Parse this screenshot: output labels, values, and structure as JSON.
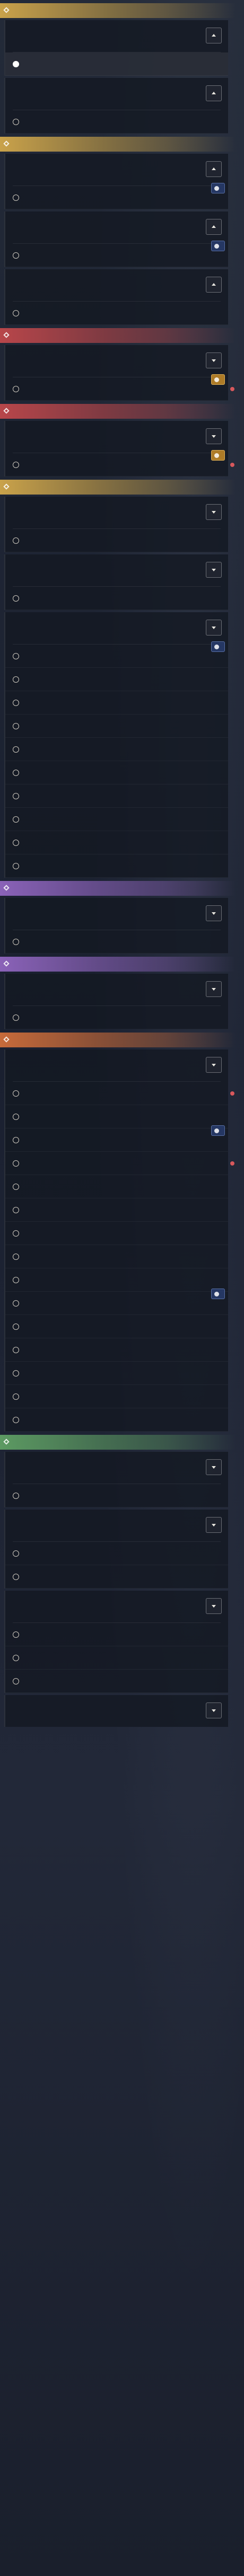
{
  "colors": {
    "gold": "#c9a24a",
    "red": "#b8464a",
    "purple": "#8a62b8",
    "orange": "#c66a3a",
    "green": "#5c9a62",
    "panel": "#14182a",
    "text": "#e8e6df"
  },
  "icons": {
    "category": "category-diamond-icon",
    "toggle_up": "chevron-up-icon",
    "toggle_down": "chevron-down-icon",
    "checkbox": "radio-circle-icon",
    "tag": "tag-badge-icon"
  },
  "sections": [
    {
      "category": "",
      "color": "gold",
      "quests": [
        {
          "title": "",
          "subtitle": "",
          "toggle": "up",
          "rows": [
            {
              "label": "",
              "highlight": true
            }
          ]
        },
        {
          "title": "",
          "subtitle": "",
          "toggle": "up",
          "rows": [
            {
              "label": "",
              "distance": ""
            }
          ]
        }
      ]
    },
    {
      "category": "",
      "color": "gold",
      "quests": [
        {
          "title": "",
          "subtitle": "",
          "toggle": "up",
          "rows": [
            {
              "label": "",
              "distance": "",
              "tag": "",
              "tag_style": "blue"
            }
          ]
        },
        {
          "title": "",
          "subtitle": "",
          "toggle": "up",
          "rows": [
            {
              "label": "",
              "distance": "",
              "tag": "",
              "tag_style": "blue"
            }
          ]
        },
        {
          "title": "",
          "subtitle": "",
          "toggle": "up",
          "rows": [
            {
              "label": "",
              "distance": ""
            }
          ]
        }
      ]
    },
    {
      "category": "",
      "color": "red",
      "quests": [
        {
          "title": "",
          "subtitle": "",
          "toggle": "down",
          "rows": [
            {
              "label": "",
              "dim": true,
              "tag": "",
              "tag_style": "amber",
              "side_dot": true
            }
          ]
        }
      ]
    },
    {
      "category": "",
      "color": "red",
      "quests": [
        {
          "title": "",
          "subtitle": "",
          "toggle": "down",
          "rows": [
            {
              "label": "",
              "dim": true,
              "tag": "",
              "tag_style": "amber",
              "side_dot": true
            }
          ]
        }
      ]
    },
    {
      "category": "",
      "color": "gold",
      "quests": [
        {
          "title": "",
          "subtitle": "",
          "toggle": "down",
          "rows": [
            {
              "label": "",
              "distance": ""
            }
          ]
        },
        {
          "title": "",
          "subtitle": "",
          "toggle": "down",
          "rows": [
            {
              "label": "",
              "distance": ""
            }
          ]
        },
        {
          "title": "",
          "subtitle": "",
          "toggle": "down",
          "rows": [
            {
              "label": "",
              "distance": "",
              "tag": "",
              "tag_style": "blue"
            },
            {
              "label": "",
              "dim": true
            },
            {
              "label": "",
              "dim": true
            },
            {
              "label": "",
              "distance": ""
            },
            {
              "label": "",
              "dim": true
            },
            {
              "label": "",
              "dim": true
            },
            {
              "label": "",
              "dim": true
            },
            {
              "label": "",
              "distance": ""
            },
            {
              "label": "",
              "dim": true
            },
            {
              "label": "",
              "dim": true
            }
          ]
        }
      ]
    },
    {
      "category": "",
      "color": "purple",
      "quests": [
        {
          "title": "",
          "subtitle": "",
          "toggle": "down",
          "rows": [
            {
              "label": "",
              "distance": ""
            }
          ]
        }
      ]
    },
    {
      "category": "",
      "color": "purple",
      "quests": [
        {
          "title": "",
          "subtitle": "",
          "toggle": "down",
          "rows": [
            {
              "label": "",
              "distance": ""
            }
          ]
        }
      ]
    },
    {
      "category": "",
      "color": "orange",
      "quests": [
        {
          "title": "",
          "subtitle": "",
          "toggle": "down",
          "rows": [
            {
              "label": "",
              "distance": "",
              "side_dot": true
            },
            {
              "label": "",
              "dim": true
            },
            {
              "label": "",
              "distance": "",
              "tag": "",
              "tag_style": "blue"
            },
            {
              "label": "",
              "distance": "",
              "side_dot": true
            },
            {
              "label": "",
              "dim": true
            },
            {
              "label": "",
              "dim": true
            },
            {
              "label": "",
              "dim": true
            },
            {
              "label": "",
              "dim": true
            },
            {
              "label": "",
              "distance": ""
            },
            {
              "label": "",
              "distance": "",
              "tag": "",
              "tag_style": "blue"
            },
            {
              "label": "",
              "dim": true
            },
            {
              "label": "",
              "distance": ""
            },
            {
              "label": "",
              "dim": true
            },
            {
              "label": "",
              "dim": true
            },
            {
              "label": "",
              "distance": ""
            }
          ]
        }
      ]
    },
    {
      "category": "",
      "color": "green",
      "quests": [
        {
          "title": "",
          "subtitle": "",
          "toggle": "down",
          "rows": [
            {
              "label": "",
              "dim": true
            }
          ]
        },
        {
          "title": "",
          "subtitle": "",
          "toggle": "down",
          "rows": [
            {
              "label": "",
              "dim": true
            },
            {
              "label": "",
              "dim": true
            }
          ]
        },
        {
          "title": "",
          "subtitle": "",
          "toggle": "down",
          "rows": [
            {
              "label": "",
              "dim": true
            },
            {
              "label": "",
              "dim": true
            },
            {
              "label": "",
              "dim": true
            }
          ]
        },
        {
          "title": "",
          "subtitle": "",
          "toggle": "down",
          "rows": []
        }
      ]
    }
  ]
}
